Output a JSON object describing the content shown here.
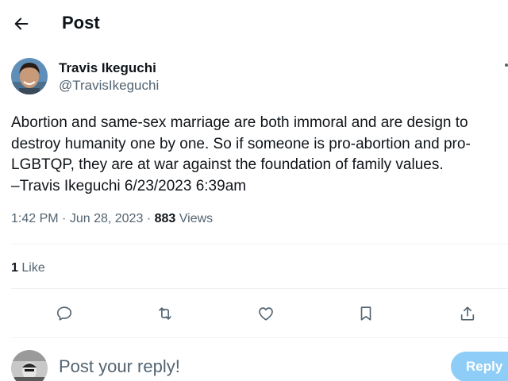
{
  "header": {
    "title": "Post",
    "back_icon": "arrow-left-icon"
  },
  "post": {
    "author": {
      "name": "Travis Ikeguchi",
      "handle": "@TravisIkeguchi"
    },
    "text_lines": [
      "Abortion and same-sex marriage are both immoral and are design to",
      "destroy humanity one by one. So if someone is pro-abortion and pro-",
      "LGBTQP, they are at war against the foundation of family values.",
      "–Travis Ikeguchi 6/23/2023 6:39am"
    ],
    "time": "1:42 PM",
    "date": "Jun 28, 2023",
    "separator": "·",
    "views_count": "883",
    "views_label": "Views",
    "likes_count": "1",
    "likes_label": "Like"
  },
  "actions": [
    {
      "name": "reply",
      "icon": "speech-bubble-icon"
    },
    {
      "name": "repost",
      "icon": "repost-arrows-icon"
    },
    {
      "name": "like",
      "icon": "heart-icon"
    },
    {
      "name": "bookmark",
      "icon": "bookmark-icon"
    },
    {
      "name": "share",
      "icon": "share-upload-icon"
    }
  ],
  "reply_box": {
    "placeholder": "Post your reply!",
    "button_label": "Reply"
  },
  "colors": {
    "text": "#0f1419",
    "secondary": "#536471",
    "divider": "#eff3f4",
    "reply_button_disabled": "#8ecdf7"
  }
}
